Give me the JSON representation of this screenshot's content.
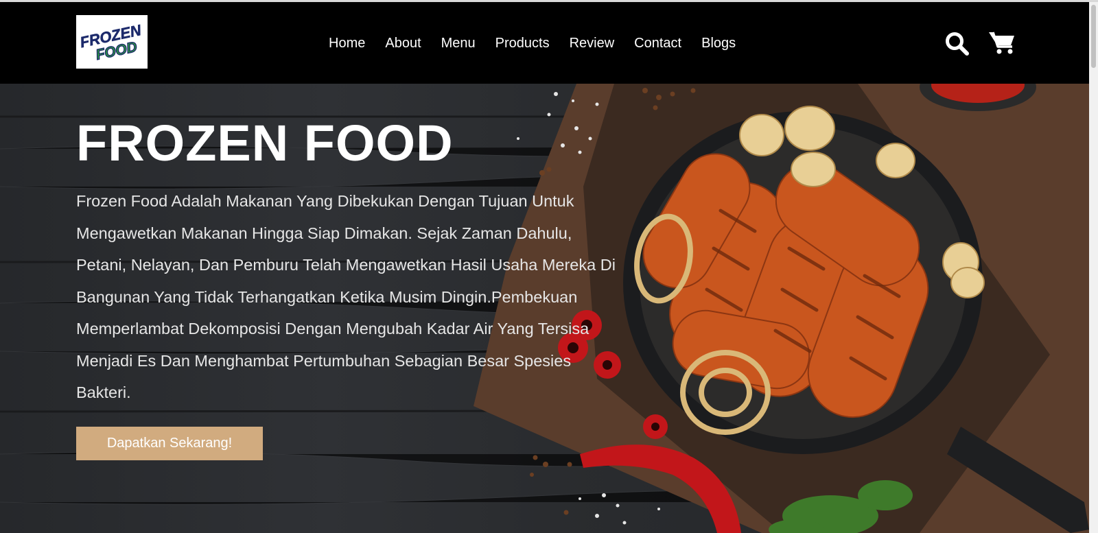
{
  "logo": {
    "line1": "FROZEN",
    "line2": "FOOD"
  },
  "nav": {
    "links": [
      "Home",
      "About",
      "Menu",
      "Products",
      "Review",
      "Contact",
      "Blogs"
    ],
    "icons": [
      "search-icon",
      "cart-icon"
    ]
  },
  "hero": {
    "title": "FROZEN FOOD",
    "description": "Frozen Food Adalah Makanan Yang Dibekukan Dengan Tujuan Untuk Mengawetkan Makanan Hingga Siap Dimakan. Sejak Zaman Dahulu, Petani, Nelayan, Dan Pemburu Telah Mengawetkan Hasil Usaha Mereka Di Bangunan Yang Tidak Terhangatkan Ketika Musim Dingin.Pembekuan Memperlambat Dekomposisi Dengan Mengubah Kadar Air Yang Tersisa Menjadi Es Dan Menghambat Pertumbuhan Sebagian Besar Spesies Bakteri.",
    "cta_label": "Dapatkan Sekarang!"
  },
  "colors": {
    "navbar_bg": "#000000",
    "nav_text": "#ffffff",
    "cta_bg": "#d1ab7f",
    "hero_bg": "#2b2d30",
    "logo_blue": "#1c2a6b",
    "logo_green": "#2e9e3e"
  }
}
